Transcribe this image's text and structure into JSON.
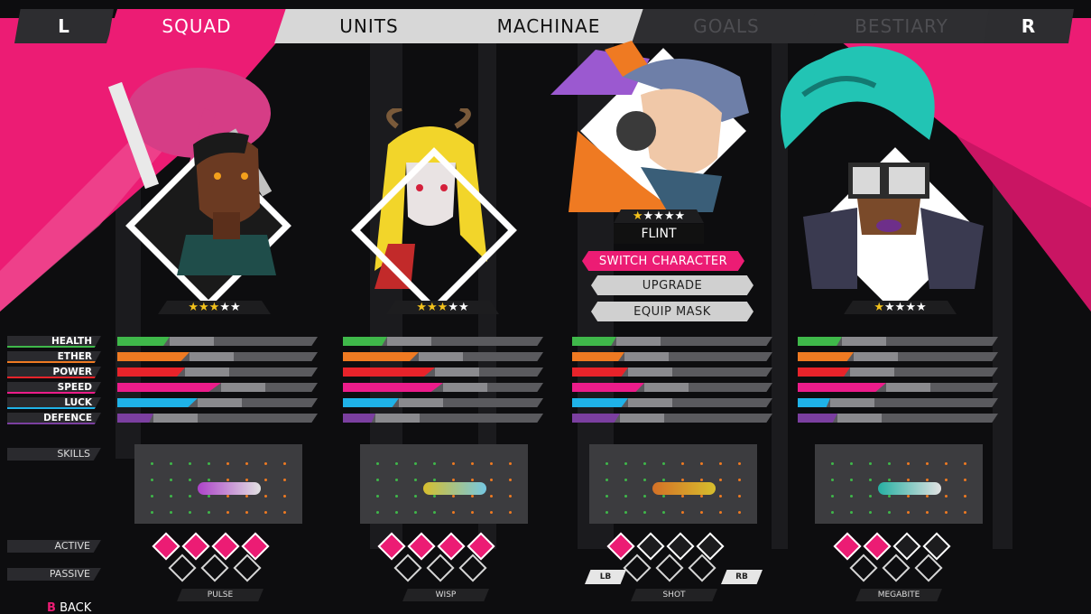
{
  "nav": {
    "left_button": "L",
    "right_button": "R",
    "tabs": [
      {
        "label": "SQUAD",
        "state": "active"
      },
      {
        "label": "UNITS",
        "state": "light"
      },
      {
        "label": "MACHINAE",
        "state": "light"
      },
      {
        "label": "GOALS",
        "state": "dim"
      },
      {
        "label": "BESTIARY",
        "state": "dim"
      }
    ]
  },
  "stats": {
    "labels": [
      "HEALTH",
      "ETHER",
      "POWER",
      "SPEED",
      "LUCK",
      "DEFENCE"
    ],
    "colors": [
      "#3fb84a",
      "#ef7a22",
      "#e8232a",
      "#ec1c8a",
      "#1fb2e8",
      "#7b3fa0"
    ]
  },
  "side_labels": {
    "skills": "SKILLS",
    "active": "ACTIVE",
    "passive": "PASSIVE"
  },
  "back": {
    "key": "B",
    "label": "BACK"
  },
  "selected_menu": {
    "name": "FLINT",
    "switch": "SWITCH CHARACTER",
    "upgrade": "UPGRADE",
    "equip": "EQUIP MASK"
  },
  "shoulder_hints": {
    "lb": "LB",
    "rb": "RB"
  },
  "characters": [
    {
      "skill": "PULSE",
      "stars": 3,
      "stat_values": [
        0.26,
        0.36,
        0.34,
        0.52,
        0.4,
        0.18
      ]
    },
    {
      "skill": "WISP",
      "stars": 3,
      "stat_values": [
        0.22,
        0.38,
        0.46,
        0.5,
        0.28,
        0.16
      ]
    },
    {
      "skill": "SHOT",
      "stars": 1,
      "stat_values": [
        0.22,
        0.26,
        0.28,
        0.36,
        0.28,
        0.24
      ]
    },
    {
      "skill": "MEGABITE",
      "stars": 1,
      "stat_values": [
        0.22,
        0.28,
        0.26,
        0.44,
        0.16,
        0.2
      ]
    }
  ],
  "colors": {
    "accent": "#ec1c74",
    "star": "#f3c21c",
    "teal": "#22c4b4",
    "purple": "#9b59d0"
  },
  "icons": [
    "pulse-skill-icon",
    "wisp-skill-icon",
    "shot-skill-icon",
    "megabite-skill-icon"
  ]
}
